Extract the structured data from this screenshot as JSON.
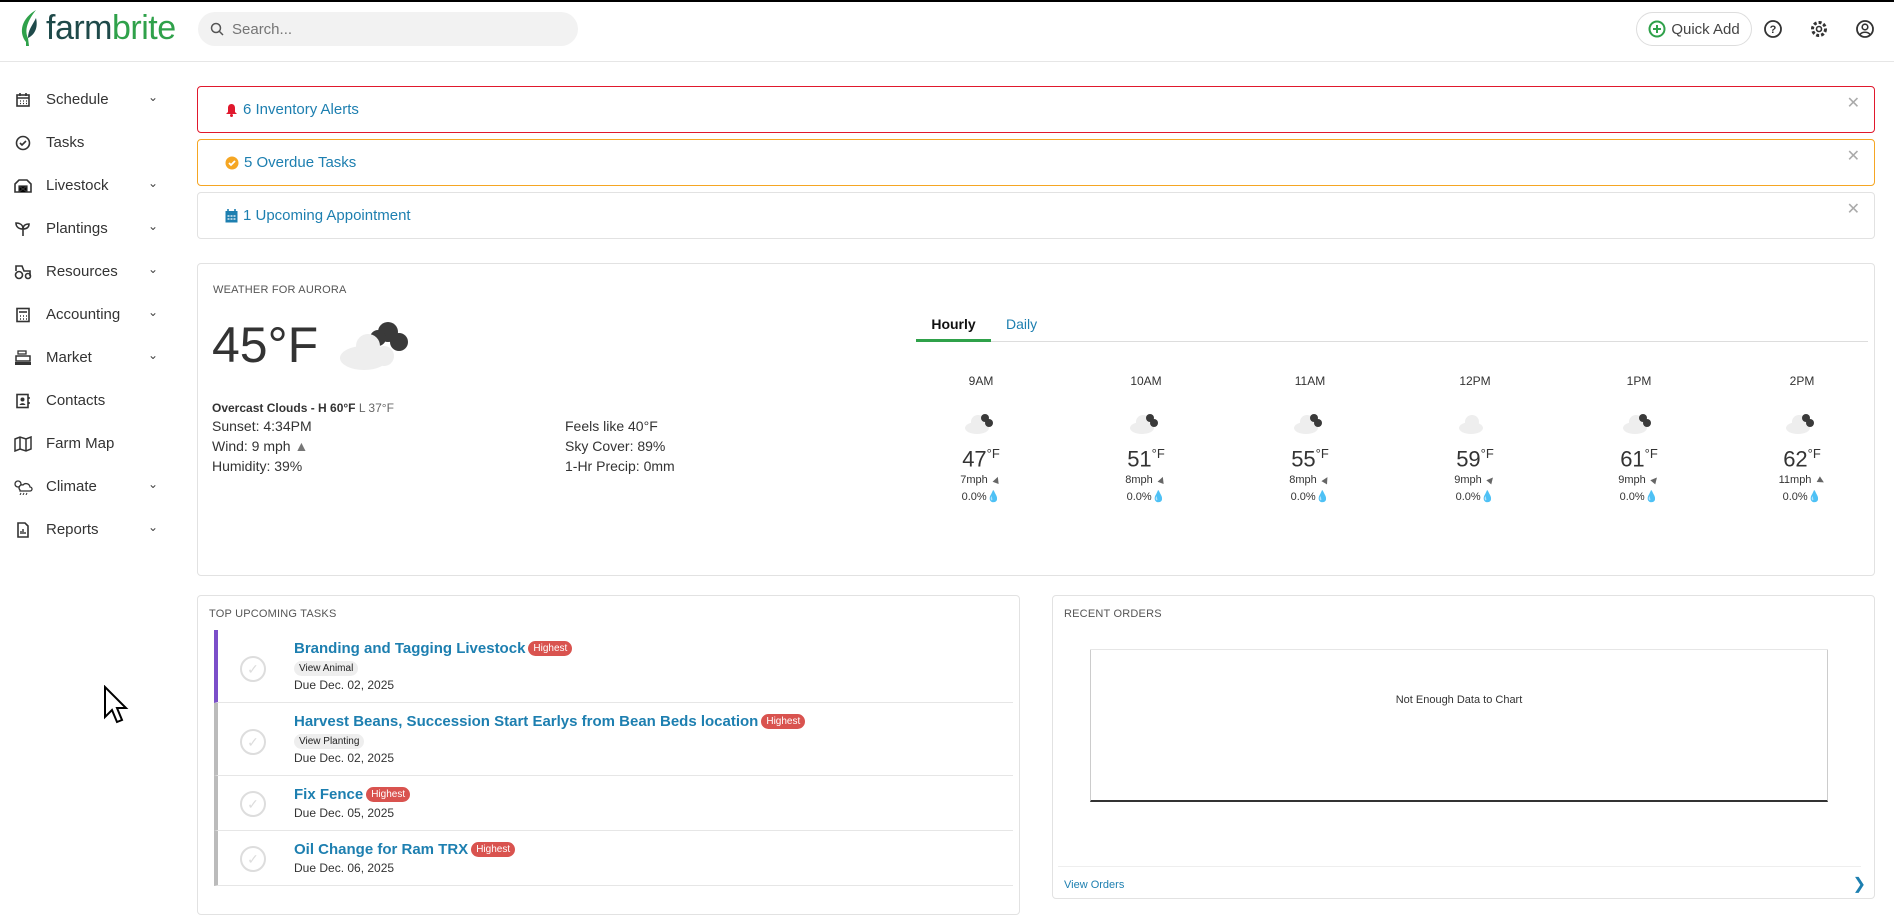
{
  "header": {
    "logo_part1": "farm",
    "logo_part2": "brite",
    "search_placeholder": "Search...",
    "quick_add": "Quick Add"
  },
  "sidebar": {
    "items": [
      {
        "label": "Schedule",
        "icon": "calendar-icon",
        "chevron": true
      },
      {
        "label": "Tasks",
        "icon": "check-circle-icon",
        "chevron": false
      },
      {
        "label": "Livestock",
        "icon": "barn-icon",
        "chevron": true
      },
      {
        "label": "Plantings",
        "icon": "sprout-icon",
        "chevron": true
      },
      {
        "label": "Resources",
        "icon": "tractor-icon",
        "chevron": true
      },
      {
        "label": "Accounting",
        "icon": "calculator-icon",
        "chevron": true
      },
      {
        "label": "Market",
        "icon": "cash-register-icon",
        "chevron": true
      },
      {
        "label": "Contacts",
        "icon": "contact-book-icon",
        "chevron": false
      },
      {
        "label": "Farm Map",
        "icon": "map-icon",
        "chevron": false
      },
      {
        "label": "Climate",
        "icon": "weather-icon",
        "chevron": true
      },
      {
        "label": "Reports",
        "icon": "report-icon",
        "chevron": true
      }
    ]
  },
  "alerts": [
    {
      "text": "6 Inventory Alerts",
      "color": "#e0182d",
      "icon": "bell-icon"
    },
    {
      "text": "5 Overdue Tasks",
      "color": "#f5a623",
      "icon": "check-badge-icon"
    },
    {
      "text": "1 Upcoming Appointment",
      "color": "#e2e2e2",
      "icon": "calendar-icon"
    }
  ],
  "weather": {
    "title": "Weather for Aurora",
    "temp": "45°F",
    "summary": "Overcast Clouds - H 60°F",
    "low": "L 37°F",
    "sunset": "Sunset: 4:34PM",
    "wind": "Wind: 9 mph",
    "humidity": "Humidity: 39%",
    "feels": "Feels like 40°F",
    "sky": "Sky Cover: 89%",
    "precip": "1-Hr Precip: 0mm",
    "tabs": {
      "hourly": "Hourly",
      "daily": "Daily"
    },
    "hours": [
      {
        "time": "9AM",
        "temp": "47",
        "unit": "°F",
        "wind": "7mph",
        "precip": "0.0%"
      },
      {
        "time": "10AM",
        "temp": "51",
        "unit": "°F",
        "wind": "8mph",
        "precip": "0.0%"
      },
      {
        "time": "11AM",
        "temp": "55",
        "unit": "°F",
        "wind": "8mph",
        "precip": "0.0%"
      },
      {
        "time": "12PM",
        "temp": "59",
        "unit": "°F",
        "wind": "9mph",
        "precip": "0.0%"
      },
      {
        "time": "1PM",
        "temp": "61",
        "unit": "°F",
        "wind": "9mph",
        "precip": "0.0%"
      },
      {
        "time": "2PM",
        "temp": "62",
        "unit": "°F",
        "wind": "11mph",
        "precip": "0.0%"
      }
    ]
  },
  "tasks": {
    "title": "Top Upcoming Tasks",
    "items": [
      {
        "title": "Branding and Tagging Livestock",
        "priority": "Highest",
        "link": "View Animal",
        "due": "Due Dec. 02, 2025"
      },
      {
        "title": "Harvest Beans, Succession Start Earlys from Bean Beds location",
        "priority": "Highest",
        "link": "View Planting",
        "due": "Due Dec. 02, 2025"
      },
      {
        "title": "Fix Fence",
        "priority": "Highest",
        "due": "Due Dec. 05, 2025"
      },
      {
        "title": "Oil Change for Ram TRX",
        "priority": "Highest",
        "due": "Due Dec. 06, 2025"
      }
    ]
  },
  "orders": {
    "title": "Recent Orders",
    "empty": "Not Enough Data to Chart",
    "view": "View Orders"
  }
}
